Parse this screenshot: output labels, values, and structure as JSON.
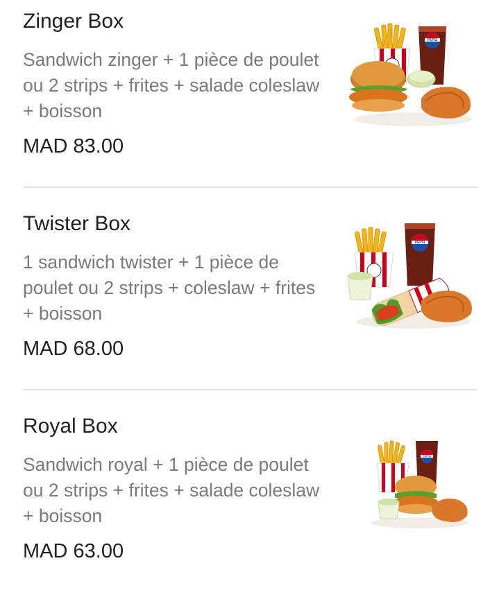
{
  "menu": {
    "items": [
      {
        "name": "Zinger Box",
        "description": "Sandwich zinger + 1 pièce de poulet ou 2 strips + frites + salade coleslaw + boisson",
        "price": "MAD 83.00",
        "image_icon": "zinger-box-meal-icon"
      },
      {
        "name": "Twister Box",
        "description": "1 sandwich twister + 1 pièce de poulet ou 2 strips + coleslaw + frites + boisson",
        "price": "MAD 68.00",
        "image_icon": "twister-box-meal-icon"
      },
      {
        "name": "Royal Box",
        "description": "Sandwich royal + 1 pièce de poulet ou 2 strips + frites + salade coleslaw + boisson",
        "price": "MAD 63.00",
        "image_icon": "royal-box-meal-icon"
      }
    ]
  },
  "colors": {
    "title_text": "#202124",
    "description_text": "#7a7a7a",
    "divider": "#e3e3e3",
    "kfc_red": "#d0021b",
    "pepsi_blue": "#1f4fa0"
  }
}
